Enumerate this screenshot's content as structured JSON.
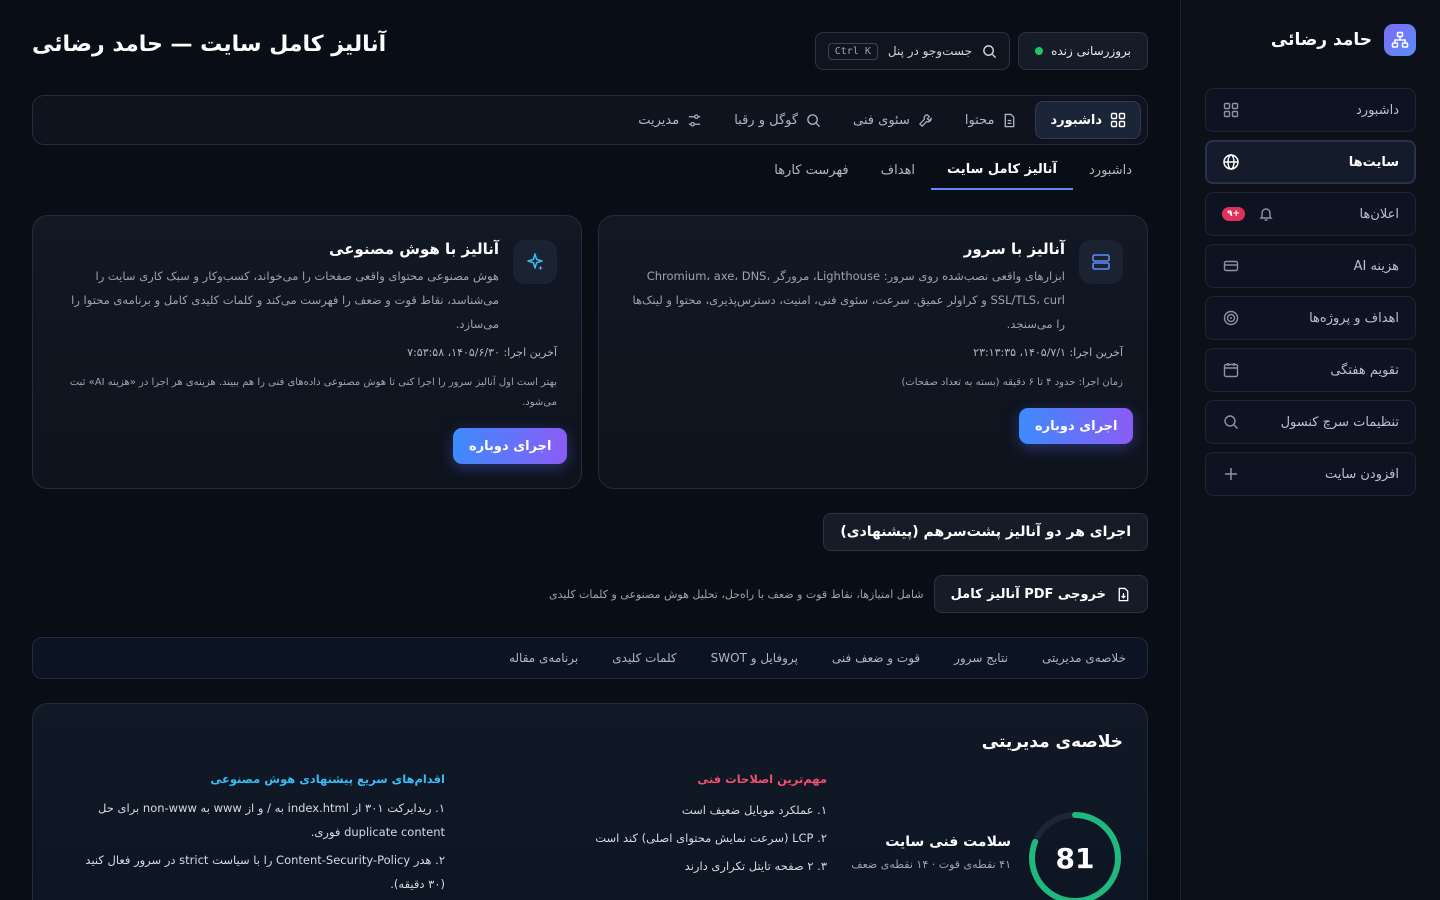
{
  "sidebar": {
    "brand": "حامد رضائی",
    "items": [
      {
        "label": "داشبورد",
        "icon": "grid-icon"
      },
      {
        "label": "سایت‌ها",
        "icon": "globe-icon",
        "active": true
      },
      {
        "label": "اعلان‌ها",
        "icon": "bell-icon",
        "badge": "+۹"
      },
      {
        "label": "هزینه AI",
        "icon": "card-icon"
      },
      {
        "label": "اهداف و پروژه‌ها",
        "icon": "target-icon"
      },
      {
        "label": "تقویم هفتگی",
        "icon": "calendar-icon"
      },
      {
        "label": "تنظیمات سرچ کنسول",
        "icon": "search-icon"
      },
      {
        "label": "افزودن سایت",
        "icon": "plus-icon"
      }
    ]
  },
  "header": {
    "title": "آنالیز کامل سایت — حامد رضائی",
    "live_label": "بروزرسانی زنده",
    "search_label": "جست‌وجو در پنل",
    "search_kbd": "Ctrl K"
  },
  "nav": {
    "items": [
      {
        "label": "داشبورد",
        "icon": "grid-icon"
      },
      {
        "label": "محتوا",
        "icon": "document-icon"
      },
      {
        "label": "سئوی فنی",
        "icon": "wrench-icon"
      },
      {
        "label": "گوگل و رقبا",
        "icon": "search-icon"
      },
      {
        "label": "مدیریت",
        "icon": "sliders-icon"
      }
    ]
  },
  "subtabs": [
    "داشبورد",
    "آنالیز کامل سایت",
    "اهداف",
    "فهرست کارها"
  ],
  "server_card": {
    "title": "آنالیز با سرور",
    "desc": "ابزارهای واقعی نصب‌شده روی سرور: Lighthouse، مرورگر Chromium، axe، DNS، SSL/TLS، curl و کراولر عمیق. سرعت، سئوی فنی، امنیت، دسترس‌پذیری، محتوا و لینک‌ها را می‌سنجد.",
    "last_run": "آخرین اجرا: ۱۴۰۵/۷/۱، ۲۳:۱۳:۳۵",
    "note": "زمان اجرا: حدود ۴ تا ۶ دقیقه (بسته به تعداد صفحات)",
    "button": "اجرای دوباره"
  },
  "ai_card": {
    "title": "آنالیز با هوش مصنوعی",
    "desc": "هوش مصنوعی محتوای واقعی صفحات را می‌خواند، کسب‌وکار و سبک کاری سایت را می‌شناسد، نقاط قوت و ضعف را فهرست می‌کند و کلمات کلیدی کامل و برنامه‌ی محتوا را می‌سازد.",
    "last_run": "آخرین اجرا: ۱۴۰۵/۶/۳۰، ۷:۵۳:۵۸",
    "note": "بهتر است اول آنالیز سرور را اجرا کنی تا هوش مصنوعی داده‌های فنی را هم ببیند. هزینه‌ی هر اجرا در «هزینه AI» ثبت می‌شود.",
    "button": "اجرای دوباره"
  },
  "run_both_label": "اجرای هر دو آنالیز پشت‌سرهم (پیشنهادی)",
  "pdf": {
    "button": "خروجی PDF آنالیز کامل",
    "note": "شامل امتیازها، نقاط قوت و ضعف با راه‌حل، تحلیل هوش مصنوعی و کلمات کلیدی"
  },
  "section_tabs": [
    "خلاصه‌ی مدیریتی",
    "نتایج سرور",
    "قوت و ضعف فنی",
    "پروفایل و SWOT",
    "کلمات کلیدی",
    "برنامه‌ی مقاله"
  ],
  "summary": {
    "title": "خلاصه‌ی مدیریتی",
    "score": "81",
    "score_fraction": 0.81,
    "health_title": "سلامت فنی سایت",
    "health_sub": "۴۱ نقطه‌ی قوت · ۱۴ نقطه‌ی ضعف",
    "fixes_title": "مهم‌ترین اصلاحات فنی",
    "fixes": [
      "۱. عملکرد موبایل ضعیف است",
      "۲. LCP (سرعت نمایش محتوای اصلی) کند است",
      "۳. ۲ صفحه تایتل تکراری دارند"
    ],
    "quick_title": "اقدام‌های سریع پیشنهادی هوش مصنوعی",
    "quick": [
      "۱. ریدایرکت ۳۰۱ از index.html به / و از www به non-www برای حل duplicate content فوری.",
      "۲. هدر Content-Security-Policy را با سیاست strict در سرور فعال کنید (۳۰ دقیقه)."
    ]
  },
  "colors": {
    "accent": "#5b8cf6",
    "gauge": "#1fb980",
    "fixes_head": "#f0506e",
    "quick_head": "#38bdf8"
  }
}
